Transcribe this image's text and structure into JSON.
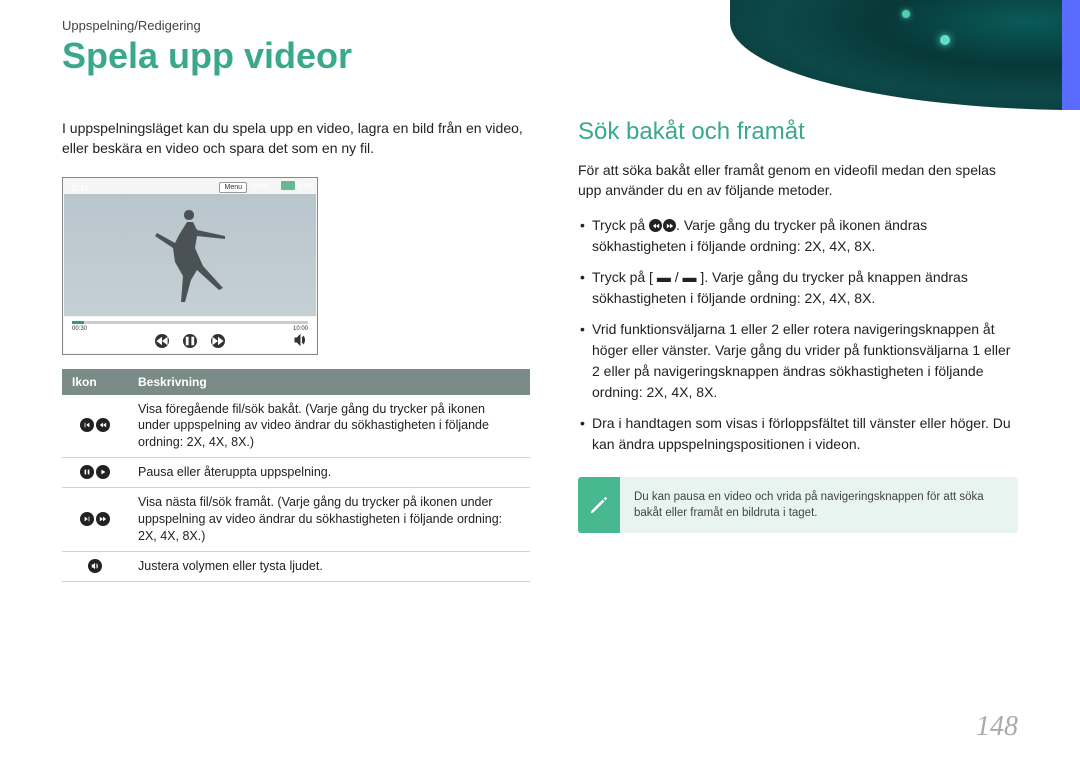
{
  "breadcrumb": "Uppspelning/Redigering",
  "title": "Spela upp videor",
  "intro": "I uppspelningsläget kan du spela upp en video, lagra en bild från en video, eller beskära en video och spara det som en ny fil.",
  "video_preview": {
    "counter": "1/ 10",
    "menu": "Menu",
    "stopp": "Stopp",
    "tabild": "Ta bild",
    "time_start": "00:30",
    "time_end": "10:00"
  },
  "table": {
    "headers": {
      "icon": "Ikon",
      "desc": "Beskrivning"
    },
    "rows": [
      {
        "desc": "Visa föregående fil/sök bakåt. (Varje gång du trycker på ikonen under uppspelning av video ändrar du sökhastigheten i följande ordning: 2X, 4X, 8X.)"
      },
      {
        "desc": "Pausa eller återuppta uppspelning."
      },
      {
        "desc": "Visa nästa fil/sök framåt. (Varje gång du trycker på ikonen under uppspelning av video ändrar du sökhastigheten i följande ordning: 2X, 4X, 8X.)"
      },
      {
        "desc": "Justera volymen eller tysta ljudet."
      }
    ]
  },
  "right": {
    "heading": "Sök bakåt och framåt",
    "para": "För att söka bakåt eller framåt genom en videofil medan den spelas upp använder du en av följande metoder.",
    "bullets": [
      {
        "pre": "Tryck på ",
        "post": ". Varje gång du trycker på ikonen ändras sökhastigheten i följande ordning: 2X, 4X, 8X."
      },
      {
        "text": "Tryck på [ ▬ / ▬ ]. Varje gång du trycker på knappen ändras sökhastigheten i följande ordning: 2X, 4X, 8X."
      },
      {
        "text": "Vrid funktionsväljarna 1 eller 2 eller rotera navigeringsknappen åt höger eller vänster. Varje gång du vrider på funktionsväljarna 1 eller 2 eller på navigeringsknappen ändras sökhastigheten i följande ordning: 2X, 4X, 8X."
      },
      {
        "text": "Dra i handtagen som visas i förloppsfältet till vänster eller höger. Du kan ändra uppspelningspositionen i videon."
      }
    ],
    "note": "Du kan pausa en video och vrida på navigeringsknappen för att söka bakåt eller framåt en bildruta i taget."
  },
  "page_number": "148"
}
